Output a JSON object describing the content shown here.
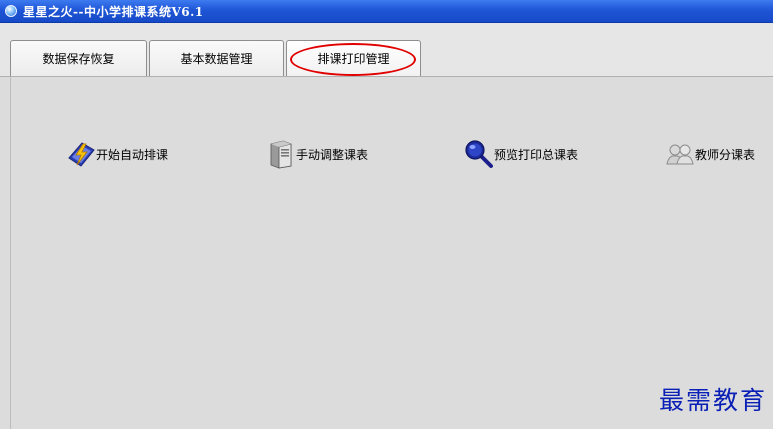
{
  "window": {
    "title": "星星之火--中小学排课系统V6.1",
    "icon": "app-globe-icon"
  },
  "tabs": [
    {
      "label": "数据保存恢复",
      "selected": false
    },
    {
      "label": "基本数据管理",
      "selected": false
    },
    {
      "label": "排课打印管理",
      "selected": true,
      "highlight": "#e00000"
    }
  ],
  "actions": [
    {
      "label": "开始自动排课",
      "icon": "lightning-app-icon"
    },
    {
      "label": "手动调整课表",
      "icon": "computer-tower-icon"
    },
    {
      "label": "预览打印总课表",
      "icon": "magnifier-icon"
    },
    {
      "label": "教师分课表",
      "icon": "users-icon"
    }
  ],
  "watermark": {
    "text": "最需教育",
    "color": "#0a1fb5"
  },
  "colors": {
    "titlebar": "#1f56d6",
    "background": "#dcdcdc"
  }
}
